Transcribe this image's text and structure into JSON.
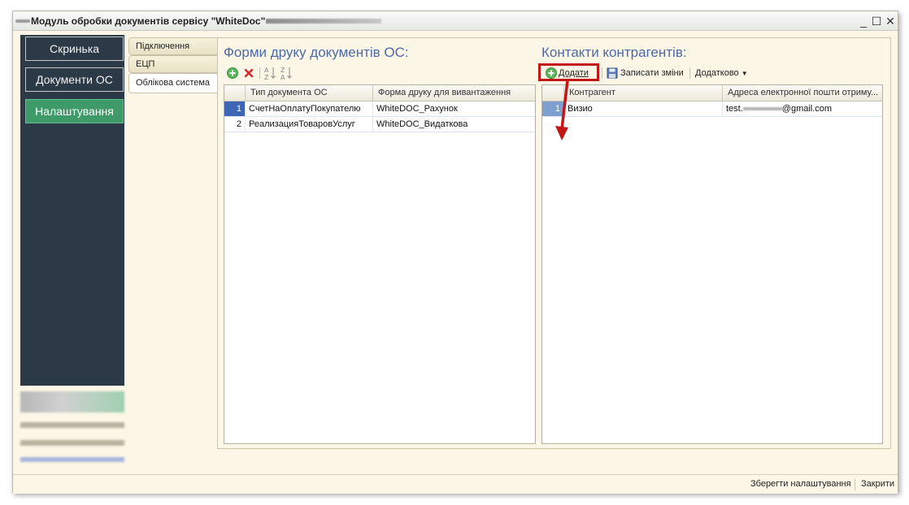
{
  "window": {
    "title": "Модуль обробки документів сервісу \"WhiteDoc\"",
    "controls": {
      "minimize": "_",
      "maximize": "☐",
      "close": "✕"
    }
  },
  "sidebar": {
    "items": [
      {
        "label": "Скринька"
      },
      {
        "label": "Документи ОС"
      },
      {
        "label": "Налаштування"
      }
    ]
  },
  "tabs": [
    {
      "label": "Підключення"
    },
    {
      "label": "ЕЦП"
    },
    {
      "label": "Облікова система"
    }
  ],
  "forms": {
    "title": "Форми друку документів ОС:",
    "columns": [
      "Тип документа ОС",
      "Форма друку для вивантаження"
    ],
    "rows": [
      {
        "n": "1",
        "type": "СчетНаОплатуПокупателю",
        "form": "WhiteDOC_Рахунок"
      },
      {
        "n": "2",
        "type": "РеализацияТоваровУслуг",
        "form": "WhiteDOC_Видаткова"
      }
    ]
  },
  "contacts": {
    "title": "Контакти контрагентів:",
    "add_label": "Додати",
    "save_label": "Записати зміни",
    "more_label": "Додатково",
    "columns": [
      "Контрагент",
      "Адреса електронної пошти отриму..."
    ],
    "rows": [
      {
        "n": "1",
        "contractor": "Визио",
        "email_prefix": "test.",
        "email_suffix": "@gmail.com"
      }
    ]
  },
  "footer": {
    "save_settings": "Зберегти налаштування",
    "close": "Закрити"
  },
  "colors": {
    "sidebar_bg": "#2c3a48",
    "active_nav": "#3f9a6a",
    "title_blue": "#4d6aa8",
    "selection": "#3d66b5",
    "highlight": "#c21717"
  }
}
